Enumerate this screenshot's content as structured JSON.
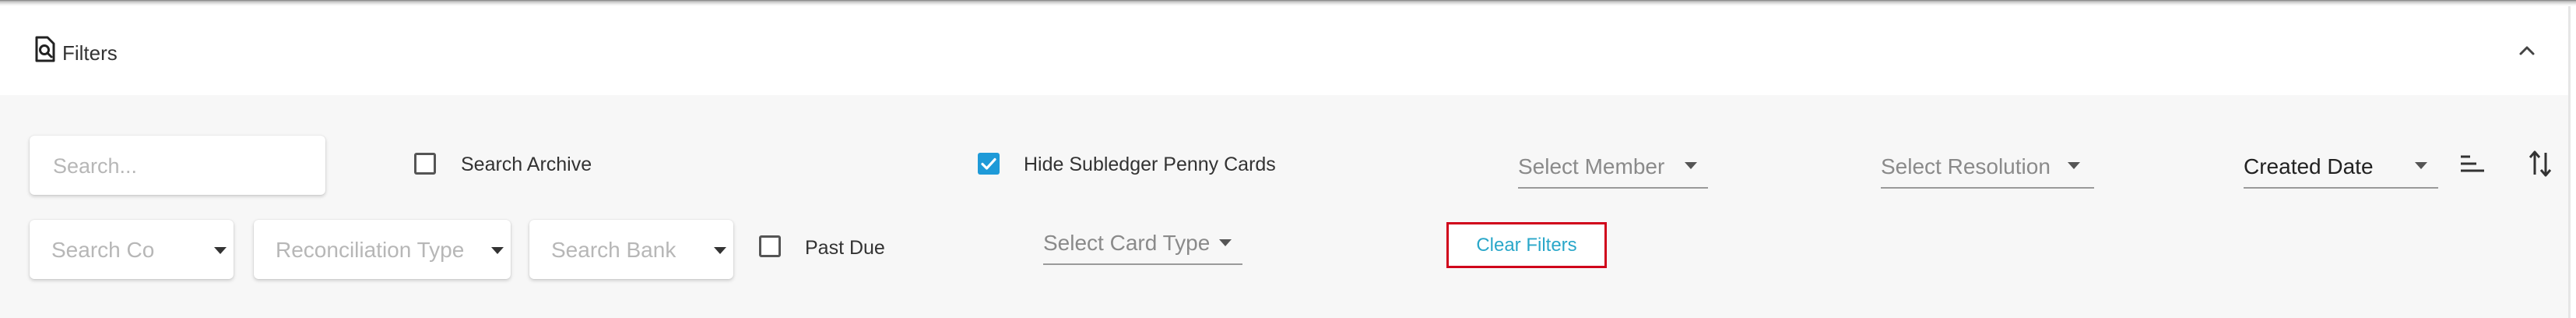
{
  "header": {
    "title": "Filters",
    "icon": "filter-search-icon",
    "collapse_icon": "chevron-up-icon"
  },
  "filters": {
    "search": {
      "placeholder": "Search..."
    },
    "search_archive": {
      "label": "Search Archive",
      "checked": false
    },
    "hide_subledger": {
      "label": "Hide Subledger Penny Cards",
      "checked": true
    },
    "select_member": {
      "placeholder": "Select Member"
    },
    "select_resolution": {
      "placeholder": "Select Resolution"
    },
    "sort_field": {
      "value": "Created Date"
    },
    "sort_options_icon": "sort-lines-icon",
    "sort_direction_icon": "sort-direction-icon",
    "search_co": {
      "placeholder": "Search Co"
    },
    "reconciliation_type": {
      "placeholder": "Reconciliation Type"
    },
    "search_bank": {
      "placeholder": "Search Bank"
    },
    "past_due": {
      "label": "Past Due",
      "checked": false
    },
    "select_card_type": {
      "placeholder": "Select Card Type"
    },
    "clear_filters": {
      "label": "Clear Filters"
    }
  },
  "colors": {
    "accent": "#1e9ad8",
    "clear_text": "#2aa7c9",
    "highlight_border": "#d0021b",
    "panel_background": "#f7f7f7"
  }
}
